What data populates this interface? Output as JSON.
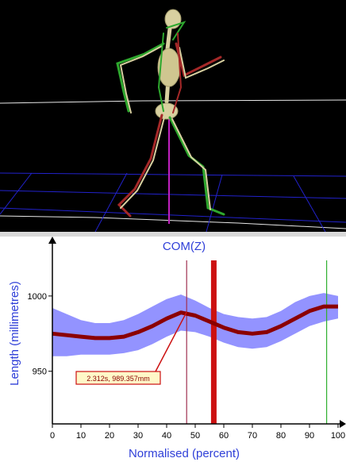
{
  "viewport": {
    "background": "#000000",
    "icons": [
      "walking-skeleton-icon"
    ],
    "colors": {
      "left_limb": "#2ea82e",
      "right_limb": "#a52828",
      "bone": "#d8d0a0",
      "com_line": "#c020c0",
      "floor_grid": "#2222cc"
    }
  },
  "chart_data": {
    "type": "line",
    "title": "COM(Z)",
    "xlabel": "Normalised (percent)",
    "ylabel": "Length (millimetres)",
    "xlim": [
      0,
      100
    ],
    "ylim": [
      915,
      1030
    ],
    "xticks": [
      0,
      10,
      20,
      30,
      40,
      50,
      60,
      70,
      80,
      90,
      100
    ],
    "yticks": [
      950,
      1000
    ],
    "grid": false,
    "series": [
      {
        "color": "#8b0000",
        "x": [
          0,
          5,
          10,
          15,
          20,
          25,
          30,
          35,
          40,
          45,
          50,
          55,
          60,
          65,
          70,
          75,
          80,
          85,
          90,
          95,
          100
        ],
        "values": [
          975,
          974,
          973,
          972,
          972,
          973,
          976,
          980,
          985,
          989,
          987,
          983,
          979,
          976,
          975,
          976,
          980,
          985,
          990,
          993,
          993
        ],
        "band_upper": [
          992,
          988,
          984,
          982,
          982,
          984,
          988,
          993,
          998,
          1001,
          997,
          992,
          988,
          986,
          985,
          986,
          990,
          996,
          1000,
          1002,
          1000
        ],
        "band_lower": [
          960,
          960,
          961,
          961,
          961,
          962,
          964,
          968,
          973,
          977,
          976,
          973,
          969,
          966,
          965,
          966,
          970,
          975,
          980,
          983,
          985
        ]
      }
    ],
    "band_color": "#8080ff",
    "markers": [
      {
        "x": 47,
        "color": "#a03050",
        "style": "thin"
      },
      {
        "x": 56.5,
        "color": "#cc1010",
        "style": "thick"
      },
      {
        "x": 96,
        "color": "#30b030",
        "style": "thin"
      }
    ],
    "annotation": {
      "text": "2.312s, 989.357mm",
      "x": 47,
      "y": 989.357
    }
  }
}
